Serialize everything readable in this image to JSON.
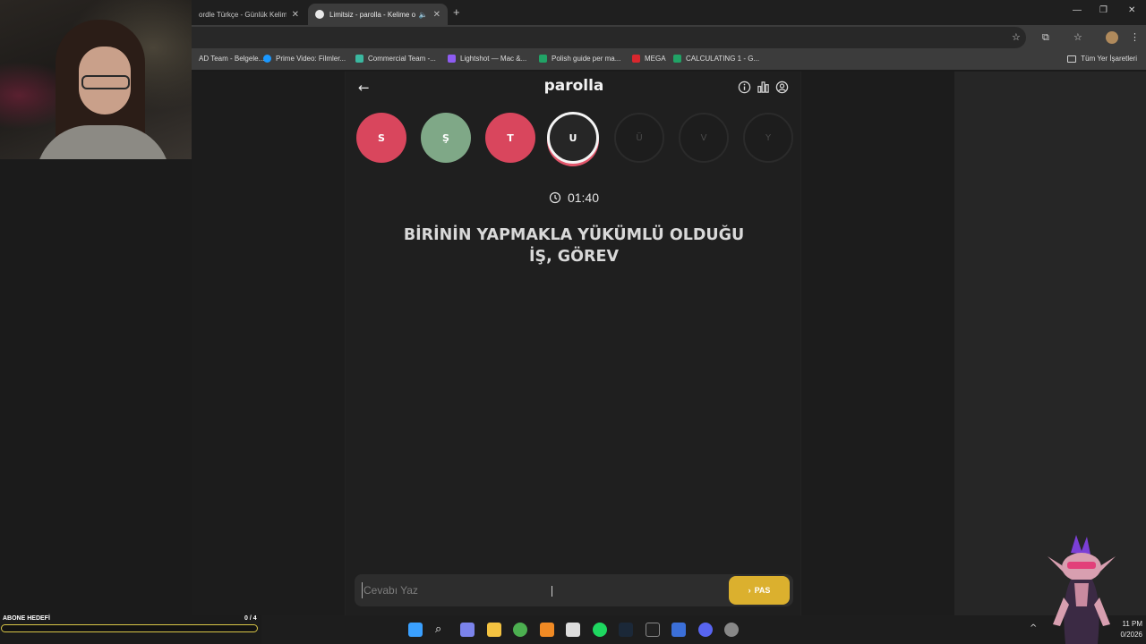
{
  "browser": {
    "tabs": [
      {
        "title": "ordle Türkçe - Günlük Kelime",
        "active": false
      },
      {
        "title": "Limitsiz - parolla - Kelime o",
        "active": true
      }
    ],
    "bookmarks": [
      {
        "label": "AD Team - Belgele...",
        "color": "#4a7fd8"
      },
      {
        "label": "Prime Video: Filmler...",
        "color": "#1a98ff"
      },
      {
        "label": "Commercial Team -...",
        "color": "#3bb8a0"
      },
      {
        "label": "Lightshot — Mac &...",
        "color": "#8e5cf2"
      },
      {
        "label": "Polish guide per ma...",
        "color": "#21a366"
      },
      {
        "label": "MEGA",
        "color": "#d9272e"
      },
      {
        "label": "CALCULATING 1 - G...",
        "color": "#21a366"
      }
    ],
    "bookmarks_right": "Tüm Yer İşaretleri"
  },
  "app": {
    "title": "parolla",
    "letters": [
      {
        "char": "S",
        "state": "wrong"
      },
      {
        "char": "Ş",
        "state": "correct"
      },
      {
        "char": "T",
        "state": "wrong"
      },
      {
        "char": "U",
        "state": "current"
      },
      {
        "char": "Ü",
        "state": "pending"
      },
      {
        "char": "V",
        "state": "pending"
      },
      {
        "char": "Y",
        "state": "pending"
      }
    ],
    "timer": "01:40",
    "question_line1": "BİRİNİN YAPMAKLA YÜKÜMLÜ OLDUĞU",
    "question_line2": "İŞ, GÖREV",
    "answer_placeholder": "Cevabı Yaz",
    "pass_label": "PAS"
  },
  "colors": {
    "wrong": "#d9465d",
    "correct": "#7fa887",
    "pass_button": "#dbb02e"
  },
  "overlay": {
    "sub_goal_label": "ABONE HEDEFİ",
    "sub_goal_count": "0 / 4",
    "sub_goal_progress": 0.0
  },
  "taskbar": {
    "time": "11 PM",
    "date": "0/2026"
  }
}
